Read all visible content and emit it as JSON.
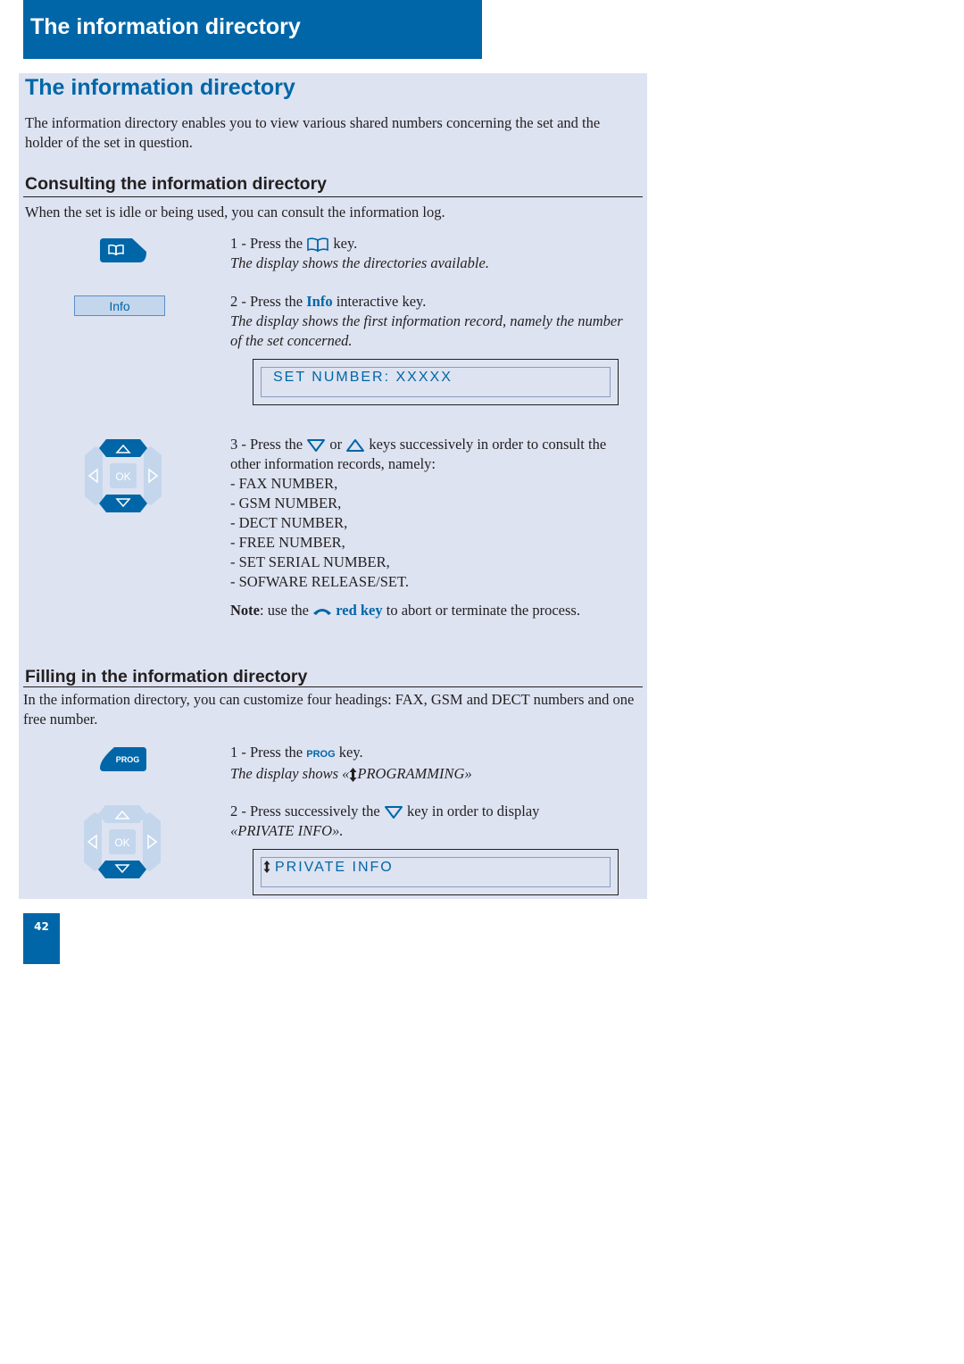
{
  "banner": {
    "title": "The information directory"
  },
  "main": {
    "title": "The information directory",
    "intro": "The information directory enables you to view various shared numbers concerning the set and the holder of the set in question."
  },
  "consulting": {
    "heading": "Consulting the information directory",
    "intro": "When the set is idle or being used, you can consult the information log.",
    "step1": {
      "prefix": "1 - Press the",
      "icon": "book-icon",
      "suffix": "key.",
      "result": "The display shows the directories available."
    },
    "info_key_label": "Info",
    "step2": {
      "prefix": "2 - Press the",
      "key": "Info",
      "suffix": "interactive key.",
      "result": "The display shows the first information record, namely the number of the set concerned."
    },
    "display1": "SET NUMBER: XXXXX",
    "navpad_ok": "OK",
    "step3": {
      "prefix": "3 - Press the",
      "down_icon": "down-arrow-icon",
      "or": "or",
      "up_icon": "up-arrow-icon",
      "suffix": "keys successively in order to consult the other information records, namely:",
      "records": [
        "- FAX NUMBER,",
        "- GSM NUMBER,",
        "- DECT NUMBER,",
        "- FREE NUMBER,",
        "- SET SERIAL NUMBER,",
        "- SOFWARE RELEASE/SET."
      ]
    },
    "note": {
      "label": "Note",
      "prefix": ": use the",
      "icon": "hang-up-icon",
      "key": "red key",
      "suffix": "to abort or terminate the process."
    }
  },
  "filling": {
    "heading": "Filling in the information directory",
    "intro": "In the information directory, you can customize four headings: FAX, GSM and DECT numbers and one free number.",
    "prog_key_label": "PROG",
    "step1": {
      "prefix": "1 - Press the",
      "key": "PROG",
      "suffix": "key.",
      "result_prefix": "The display shows «",
      "result_icon": "up-down-arrow-icon",
      "result_text": "PROGRAMMING»"
    },
    "navpad_ok": "OK",
    "step2": {
      "prefix": "2 - Press successively the",
      "icon": "down-arrow-icon",
      "suffix": "key in order to display",
      "target": "«PRIVATE INFO»."
    },
    "display2": "PRIVATE INFO"
  },
  "footer": {
    "page_number": "42"
  },
  "colors": {
    "brand_blue": "#0066a8",
    "panel_bg": "#dde3f1",
    "key_light": "#c4d6ec"
  }
}
